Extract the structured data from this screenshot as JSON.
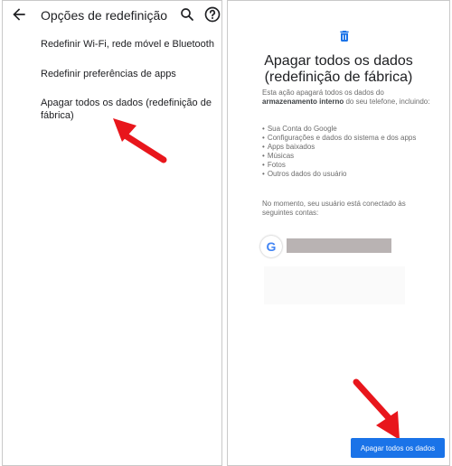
{
  "left": {
    "title": "Opções de redefinição",
    "icons": [
      "arrow-back-icon",
      "search-icon",
      "help-icon"
    ],
    "items": [
      {
        "label": "Redefinir Wi-Fi, rede móvel e Bluetooth"
      },
      {
        "label": "Redefinir preferências de apps"
      },
      {
        "label": "Apagar todos os dados (redefinição de fábrica)"
      }
    ]
  },
  "right": {
    "icon": "trash-icon",
    "title_line1": "Apagar todos os dados",
    "title_line2": "(redefinição de fábrica)",
    "desc_prefix": "Esta ação apagará todos os dados do",
    "desc_bold": "armazenamento interno",
    "desc_suffix": "do seu telefone, incluindo:",
    "bullets": [
      "Sua Conta do Google",
      "Configurações e dados do sistema e dos apps",
      "Apps baixados",
      "Músicas",
      "Fotos",
      "Outros dados do usuário"
    ],
    "accounts_text": "No momento, seu usuário está conectado às seguintes contas:",
    "google_letter": "G",
    "erase_button": "Apagar todos os dados"
  },
  "colors": {
    "accent": "#1a73e8",
    "annotation_arrow": "#e8161c",
    "masked_account": "#b9b3b3"
  }
}
